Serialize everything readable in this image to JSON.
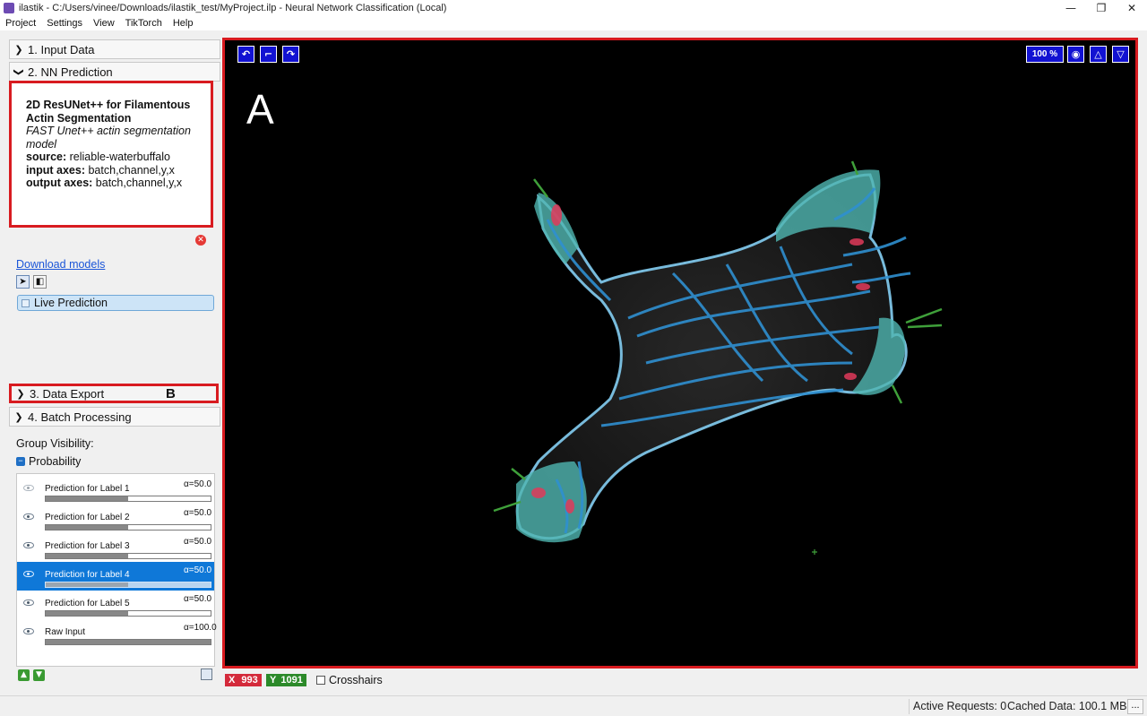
{
  "window": {
    "title": "ilastik - C:/Users/vinee/Downloads/ilastik_test/MyProject.ilp - Neural Network Classification (Local)",
    "minimize": "—",
    "maximize": "❐",
    "close": "✕"
  },
  "menu": [
    "Project",
    "Settings",
    "View",
    "TikTorch",
    "Help"
  ],
  "applets": {
    "input_data": "1. Input Data",
    "nn_prediction": "2. NN Prediction",
    "data_export": "3. Data Export",
    "batch_processing": "4. Batch Processing"
  },
  "model": {
    "title": "2D ResUNet++ for Filamentous Actin Segmentation",
    "description": "FAST Unet++ actin segmentation model",
    "source_label": "source:",
    "source_value": "reliable-waterbuffalo",
    "input_axes_label": "input axes:",
    "input_axes_value": "batch,channel,y,x",
    "output_axes_label": "output axes:",
    "output_axes_value": "batch,channel,y,x"
  },
  "download_models": "Download models",
  "live_prediction": "Live Prediction",
  "annotations": {
    "a": "A",
    "b": "B"
  },
  "group_visibility": "Group Visibility:",
  "probability_group": "Probability",
  "layers": [
    {
      "name": "Prediction for Label 1",
      "alpha": "α=50.0",
      "opacity": 0.5,
      "selected": false
    },
    {
      "name": "Prediction for Label 2",
      "alpha": "α=50.0",
      "opacity": 0.5,
      "selected": false
    },
    {
      "name": "Prediction for Label 3",
      "alpha": "α=50.0",
      "opacity": 0.5,
      "selected": false
    },
    {
      "name": "Prediction for Label 4",
      "alpha": "α=50.0",
      "opacity": 0.5,
      "selected": true
    },
    {
      "name": "Prediction for Label 5",
      "alpha": "α=50.0",
      "opacity": 0.5,
      "selected": false
    },
    {
      "name": "Raw Input",
      "alpha": "α=100.0",
      "opacity": 1.0,
      "selected": false
    }
  ],
  "viewer": {
    "zoom": "100 %",
    "icons": [
      "undo-icon",
      "fit-icon",
      "redo-icon",
      "camera-icon",
      "triangle-up-icon",
      "triangle-down-icon"
    ]
  },
  "coords": {
    "x_label": "X",
    "x_value": "993",
    "y_label": "Y",
    "y_value": "1091"
  },
  "crosshairs": "Crosshairs",
  "status": {
    "active_requests": "Active Requests: 0",
    "cached_data": "Cached Data: 100.1 MB",
    "more": "..."
  },
  "colors": {
    "highlight_red": "#d81b20",
    "viewer_button_blue": "#1212d2",
    "selection_blue": "#0f78d8",
    "x_coord_red": "#d42a3b",
    "y_coord_green": "#2c8a2a",
    "membrane_cyan": "#4fb5b0",
    "actin_blue": "#2f8fd0",
    "actin_red": "#e03a5a",
    "filopodia_green": "#3fa03a"
  }
}
